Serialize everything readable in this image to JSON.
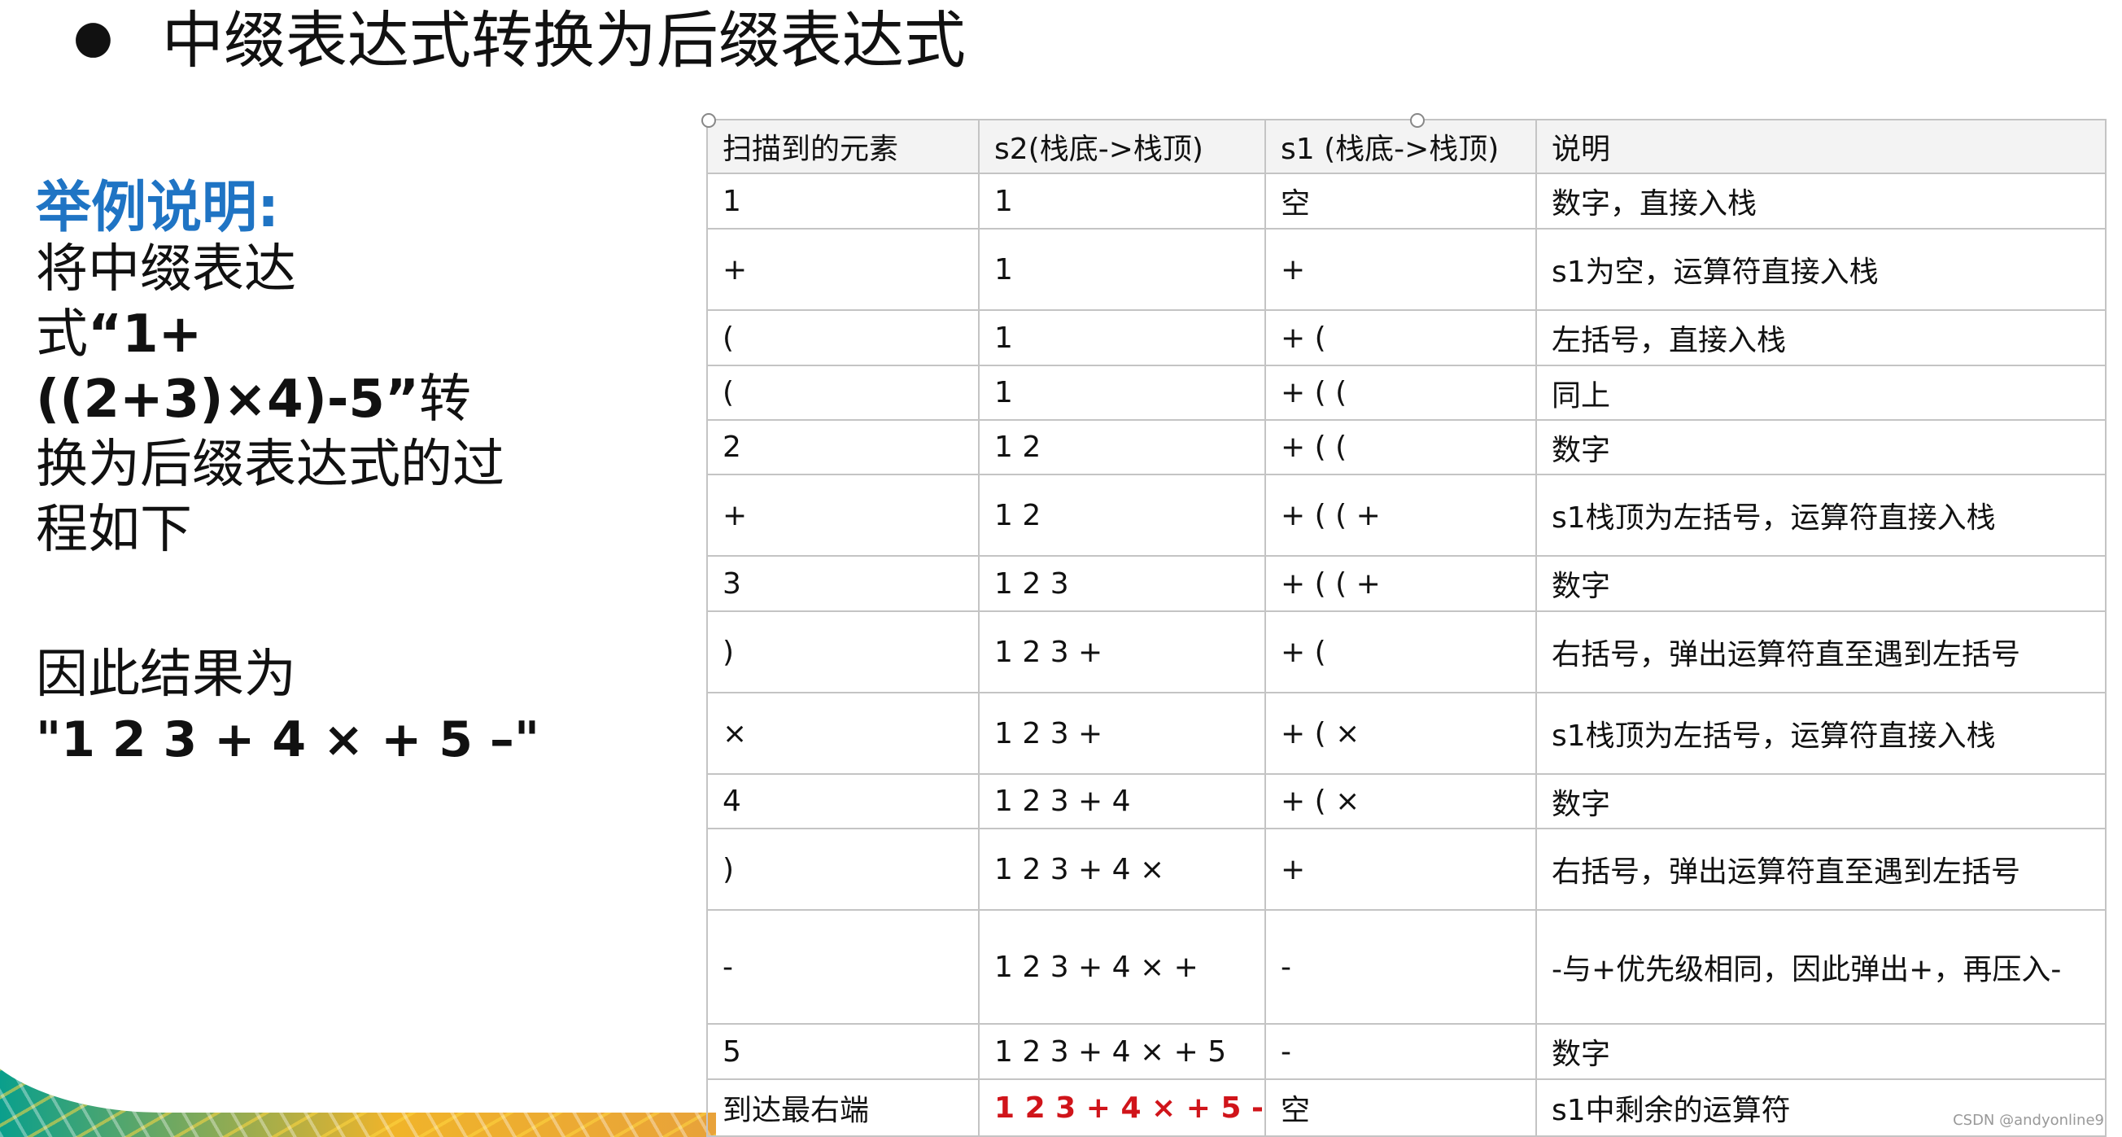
{
  "title": "中缀表达式转换为后缀表达式",
  "bullet": "●",
  "left": {
    "example_label": "举例说明:",
    "desc_line1": "将中缀表达",
    "desc_line2_prefix": "式",
    "desc_expr": "“1+((2+3)×4)-5”",
    "desc_line2_suffix": "转",
    "desc_line3": "换为后缀表达式的过",
    "desc_line4": "程如下",
    "result_label": "因此结果为",
    "result_value": "\"1 2 3 + 4 × + 5 –\""
  },
  "table": {
    "headers": [
      "扫描到的元素",
      "s2(栈底->栈顶)",
      "s1 (栈底->栈顶)",
      "说明"
    ],
    "rows": [
      {
        "scan": "1",
        "s2": "1",
        "s1": "空",
        "note": "数字，直接入栈"
      },
      {
        "scan": "+",
        "s2": "1",
        "s1": "+",
        "note": "s1为空，运算符直接入栈"
      },
      {
        "scan": "(",
        "s2": "1",
        "s1": "+ (",
        "note": "左括号，直接入栈"
      },
      {
        "scan": "(",
        "s2": "1",
        "s1": "+ ( (",
        "note": "同上"
      },
      {
        "scan": "2",
        "s2": "1 2",
        "s1": "+ ( (",
        "note": "数字"
      },
      {
        "scan": "+",
        "s2": "1 2",
        "s1": "+ ( ( +",
        "note": "s1栈顶为左括号，运算符直接入栈"
      },
      {
        "scan": "3",
        "s2": "1 2 3",
        "s1": "+ ( ( +",
        "note": "数字"
      },
      {
        "scan": ")",
        "s2": "1 2 3 +",
        "s1": "+ (",
        "note": "右括号，弹出运算符直至遇到左括号"
      },
      {
        "scan": "×",
        "s2": "1 2 3 +",
        "s1": "+ ( ×",
        "note": "s1栈顶为左括号，运算符直接入栈"
      },
      {
        "scan": "4",
        "s2": "1 2 3 + 4",
        "s1": "+ ( ×",
        "note": "数字"
      },
      {
        "scan": ")",
        "s2": "1 2 3 + 4 ×",
        "s1": "+",
        "note": "右括号，弹出运算符直至遇到左括号"
      },
      {
        "scan": "-",
        "s2": "1 2 3 + 4 × +",
        "s1": "-",
        "note": "-与+优先级相同，因此弹出+，再压入-"
      },
      {
        "scan": "5",
        "s2": "1 2 3 + 4 × + 5",
        "s1": "-",
        "note": "数字"
      },
      {
        "scan": "到达最右端",
        "s2": "1 2 3 + 4 × + 5 -",
        "s1": "空",
        "note": "s1中剩余的运算符"
      }
    ]
  },
  "colors": {
    "accent_blue": "#1f74c4",
    "result_red": "#d0141a",
    "grid": "#c4c4c4"
  },
  "watermark": "CSDN @andyonline9"
}
